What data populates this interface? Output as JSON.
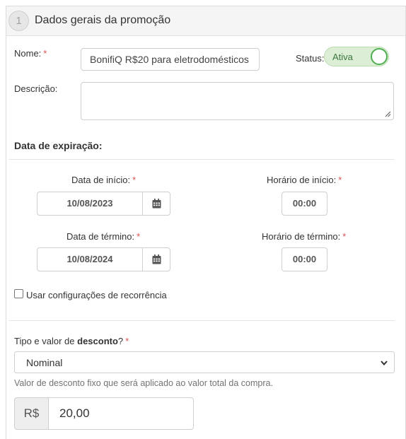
{
  "step": {
    "number": "1",
    "title": "Dados gerais da promoção"
  },
  "nome": {
    "label": "Nome:",
    "required": "*",
    "value": "BonifiQ R$20 para eletrodomésticos"
  },
  "status": {
    "label": "Status:",
    "toggle_label": "Ativa",
    "on": true,
    "color": "#4caf50"
  },
  "descricao": {
    "label": "Descrição:",
    "value": ""
  },
  "expiracao": {
    "title": "Data de expiração:",
    "inicio": {
      "label": "Data de início:",
      "required": "*",
      "value": "10/08/2023",
      "icon": "calendar-icon"
    },
    "horario_inicio": {
      "label": "Horário de início:",
      "required": "*",
      "value": "00:00"
    },
    "termino": {
      "label": "Data de término:",
      "required": "*",
      "value": "10/08/2024",
      "icon": "calendar-icon"
    },
    "horario_termino": {
      "label": "Horário de término:",
      "required": "*",
      "value": "00:00"
    }
  },
  "recorrencia": {
    "label": "Usar configurações de recorrência",
    "checked": false
  },
  "desconto": {
    "label_pre": "Tipo e valor de ",
    "label_bold": "desconto",
    "label_post": "?",
    "required": "*",
    "selected": "Nominal",
    "help": "Valor de desconto fixo que será aplicado ao valor total da compra.",
    "currency": "R$",
    "amount": "20,00"
  }
}
